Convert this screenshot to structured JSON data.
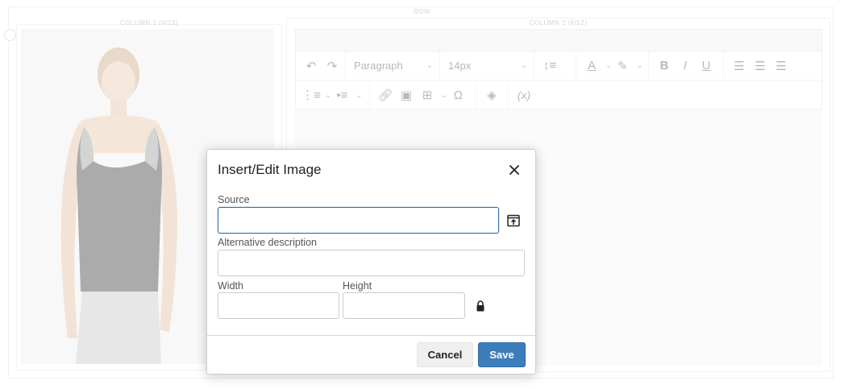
{
  "layout_labels": {
    "row": "ROW",
    "column1": "COLUMN 1 (4/12)",
    "column2": "COLUMN 2 (8/12)"
  },
  "editor": {
    "block_format": "Paragraph",
    "font_size": "14px",
    "toolbar_icons": [
      "undo-icon",
      "redo-icon",
      "line-height-icon",
      "text-color-icon",
      "highlight-icon",
      "bold-icon",
      "italic-icon",
      "underline-icon",
      "align-left-icon",
      "align-center-icon",
      "align-right-icon",
      "numbered-list-icon",
      "bullet-list-icon",
      "link-icon",
      "image-icon",
      "table-icon",
      "special-character-icon",
      "template-icon",
      "variable-icon"
    ]
  },
  "dialog": {
    "title": "Insert/Edit Image",
    "source_label": "Source",
    "source_value": "",
    "alt_label": "Alternative description",
    "alt_value": "",
    "width_label": "Width",
    "width_value": "",
    "height_label": "Height",
    "height_value": "",
    "cancel_label": "Cancel",
    "save_label": "Save"
  },
  "colors": {
    "primary": "#3d7dbb",
    "focus_border": "#2d6ba8"
  }
}
